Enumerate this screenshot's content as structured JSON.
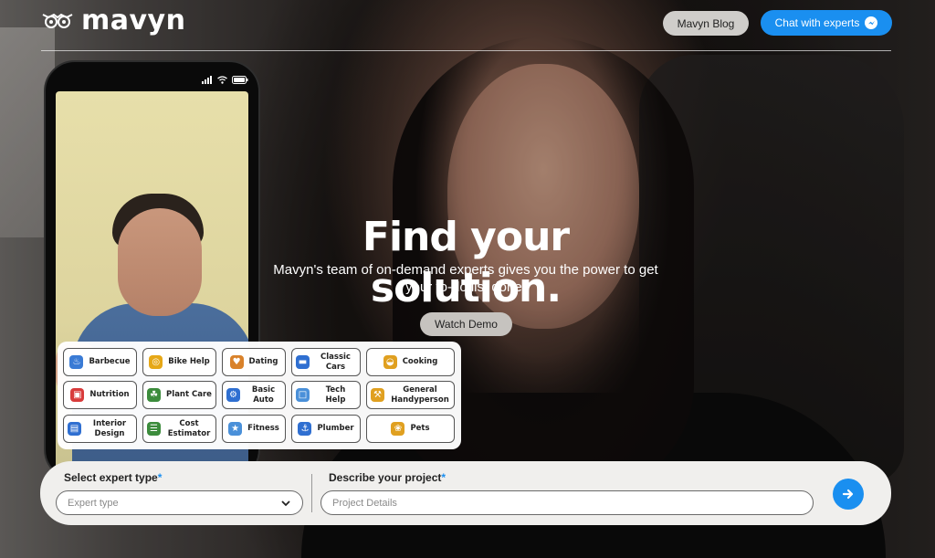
{
  "header": {
    "logo_text": "mavyn",
    "blog_button": "Mavyn Blog",
    "chat_button": "Chat with experts"
  },
  "hero": {
    "title": "Find your solution.",
    "subtitle": "Mavyn's team of on-demand experts gives you the power to get your to-do list done.",
    "demo_button": "Watch Demo"
  },
  "experts": [
    {
      "label": "Barbecue",
      "icon": "barbecue-icon",
      "color": "#3a7bd5"
    },
    {
      "label": "Bike Help",
      "icon": "bike-icon",
      "color": "#e6a817"
    },
    {
      "label": "Dating",
      "icon": "dating-icon",
      "color": "#d9822b"
    },
    {
      "label": "Classic Cars",
      "icon": "classic-car-icon",
      "color": "#2f6fd1"
    },
    {
      "label": "Cooking",
      "icon": "cooking-icon",
      "color": "#e0a020"
    },
    {
      "label": "Nutrition",
      "icon": "nutrition-icon",
      "color": "#d83b3b"
    },
    {
      "label": "Plant Care",
      "icon": "plant-care-icon",
      "color": "#3c8c3c"
    },
    {
      "label": "Basic Auto",
      "icon": "basic-auto-icon",
      "color": "#2f6fd1"
    },
    {
      "label": "Tech Help",
      "icon": "tech-help-icon",
      "color": "#4a90d9"
    },
    {
      "label": "General Handyperson",
      "icon": "handyperson-icon",
      "color": "#e0a020"
    },
    {
      "label": "Interior Design",
      "icon": "interior-design-icon",
      "color": "#2f6fd1"
    },
    {
      "label": "Cost Estimator",
      "icon": "cost-estimator-icon",
      "color": "#3c8c3c"
    },
    {
      "label": "Fitness",
      "icon": "fitness-icon",
      "color": "#4a90d9"
    },
    {
      "label": "Plumber",
      "icon": "plumber-icon",
      "color": "#2f6fd1"
    },
    {
      "label": "Pets",
      "icon": "pets-icon",
      "color": "#e0a020"
    }
  ],
  "search": {
    "expert_label": "Select expert type",
    "expert_required": "*",
    "expert_placeholder": "Expert type",
    "project_label": "Describe your project",
    "project_required": "*",
    "project_placeholder": "Project Details"
  },
  "colors": {
    "accent": "#1a8ff0",
    "chip_border": "#555555",
    "button_gray": "#cfcdca"
  }
}
